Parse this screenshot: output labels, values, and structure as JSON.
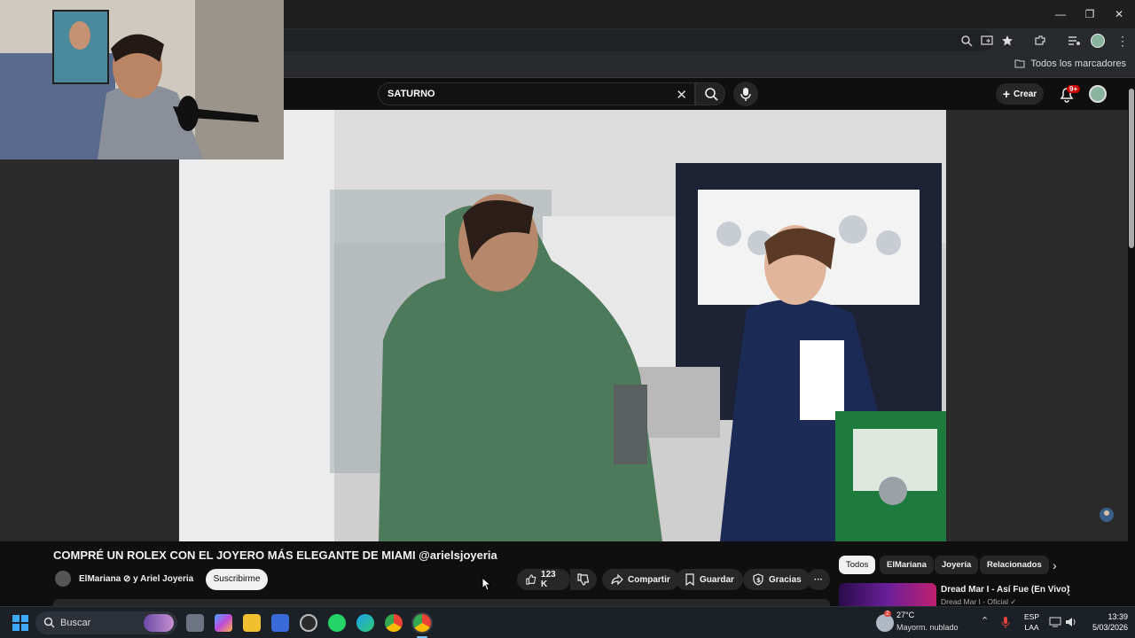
{
  "browser": {
    "bookmarks_all_label": "Todos los marcadores"
  },
  "youtube": {
    "search_value": "SATURNO",
    "create_label": "Crear",
    "notification_badge": "9+"
  },
  "video": {
    "title": "COMPRÉ UN ROLEX CON EL JOYERO MÁS ELEGANTE DE MIAMI @arielsjoyeria",
    "channel": "ElMariana ⊘ y Ariel Joyeria",
    "subscribe_label": "Suscribirme",
    "likes": "123 K",
    "share_label": "Compartir",
    "save_label": "Guardar",
    "thanks_label": "Gracias",
    "more_label": "···"
  },
  "recommendations": {
    "chips": [
      "Todos",
      "ElMariana",
      "Joyería",
      "Relacionados"
    ],
    "items": [
      {
        "title": "Dread Mar I - Así Fue (En Vivo)",
        "channel": "Dread Mar I - Oficial ✓"
      }
    ]
  },
  "taskbar": {
    "search_placeholder": "Buscar",
    "weather_temp": "27°C",
    "weather_desc": "Mayorm. nublado",
    "weather_badge": "2",
    "lang_line1": "ESP",
    "lang_line2": "LAA",
    "time": "13:39",
    "date": "5/03/2026"
  },
  "colors": {
    "youtube_bg": "#0f0f0f",
    "accent_red": "#cc0000",
    "chrome_dark": "#292a2d",
    "taskbar": "#1c2027"
  }
}
